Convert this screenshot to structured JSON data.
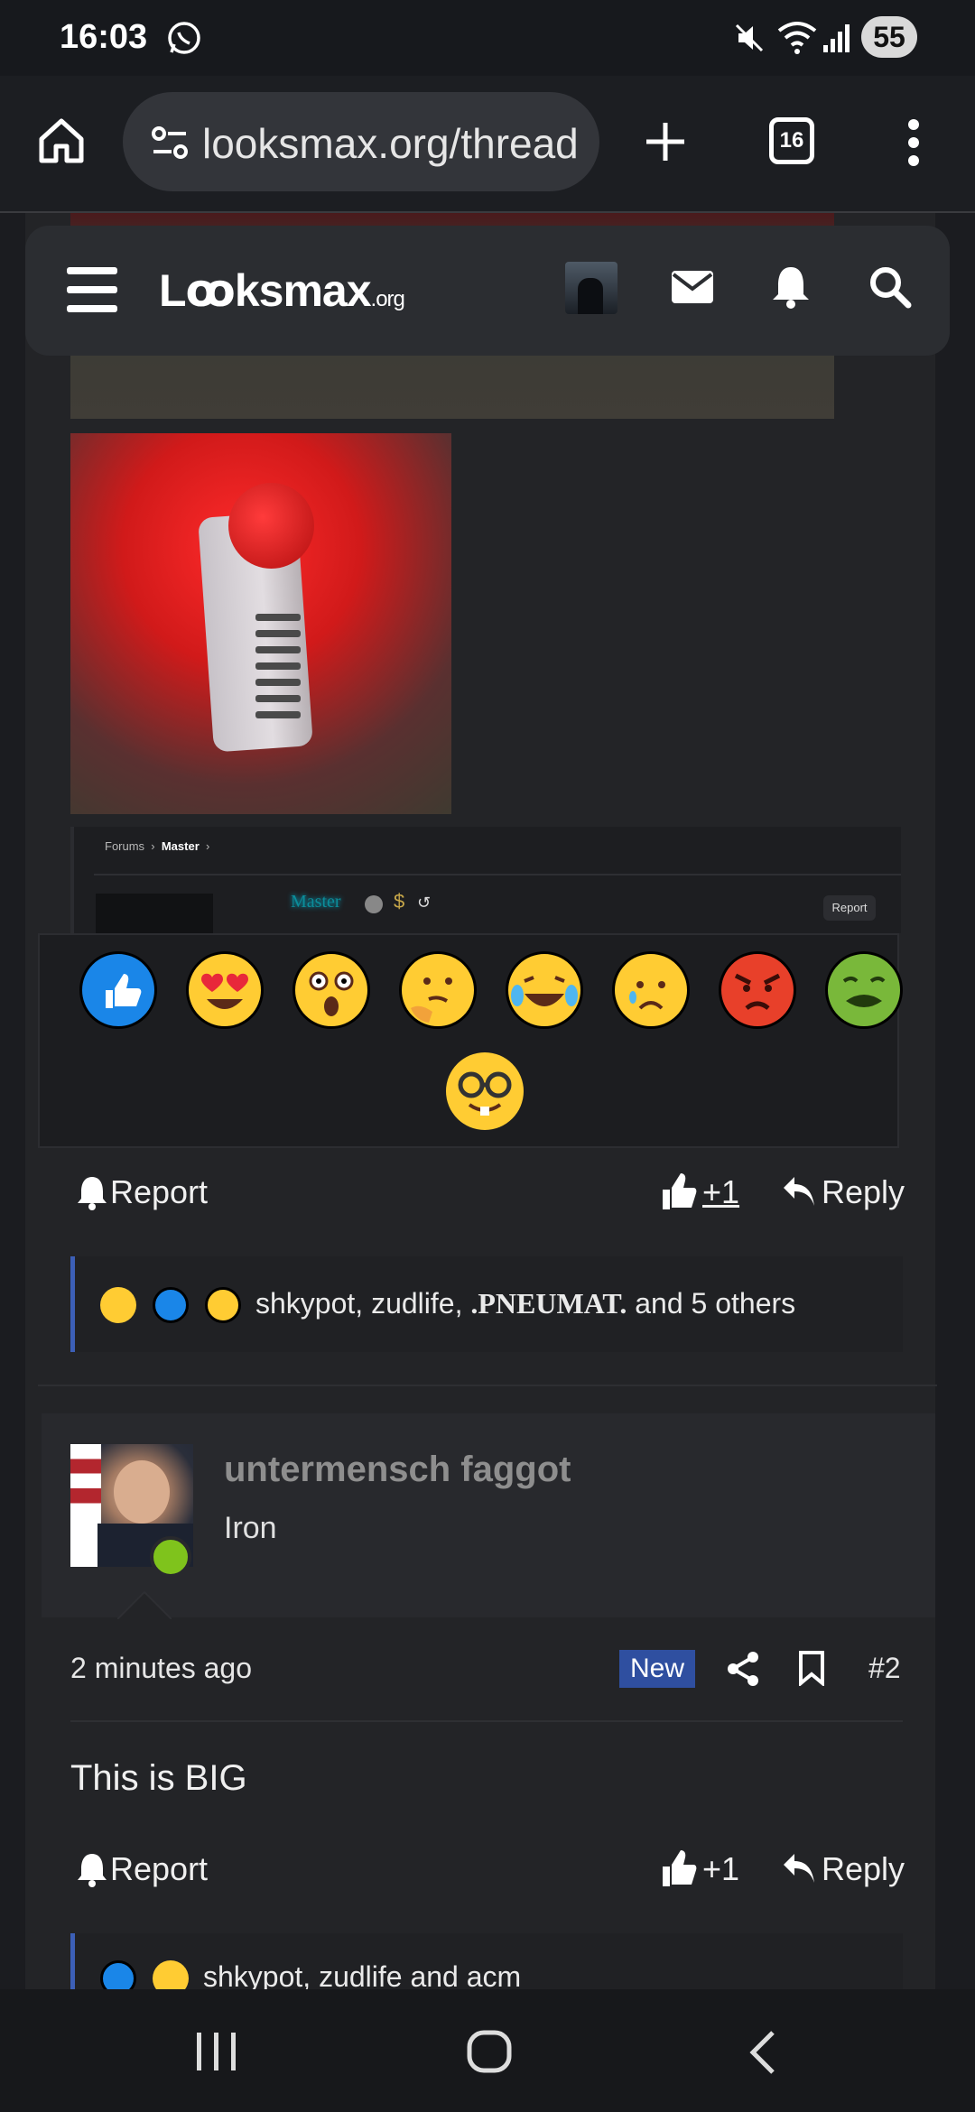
{
  "status_bar": {
    "time": "16:03",
    "battery": "55"
  },
  "browser": {
    "url": "looksmax.org/thread",
    "tab_count": "16"
  },
  "site_header": {
    "logo_main": "Lꝏksmax",
    "logo_suffix": ".org"
  },
  "embedded": {
    "breadcrumb_root": "Forums",
    "breadcrumb_child": "Master",
    "user_title": "Master",
    "report": "Report"
  },
  "post1": {
    "report": "Report",
    "like_count": "+1",
    "reply": "Reply",
    "reactions_summary": {
      "users_plain": "shkypot, zudlife, ",
      "user_bold": ".PNEUMAT.",
      "tail": " and 5 others"
    }
  },
  "post2": {
    "username": "untermensch faggot",
    "user_title": "Iron",
    "time": "2 minutes ago",
    "badge": "New",
    "post_number": "#2",
    "body": "This is BIG",
    "report": "Report",
    "like_count": "+1",
    "reply": "Reply",
    "reactions_summary": "shkypot, zudlife and acm"
  },
  "colors": {
    "accent": "#3c5fb6",
    "online": "#7fc31c",
    "new_badge": "#2f4fa0"
  }
}
